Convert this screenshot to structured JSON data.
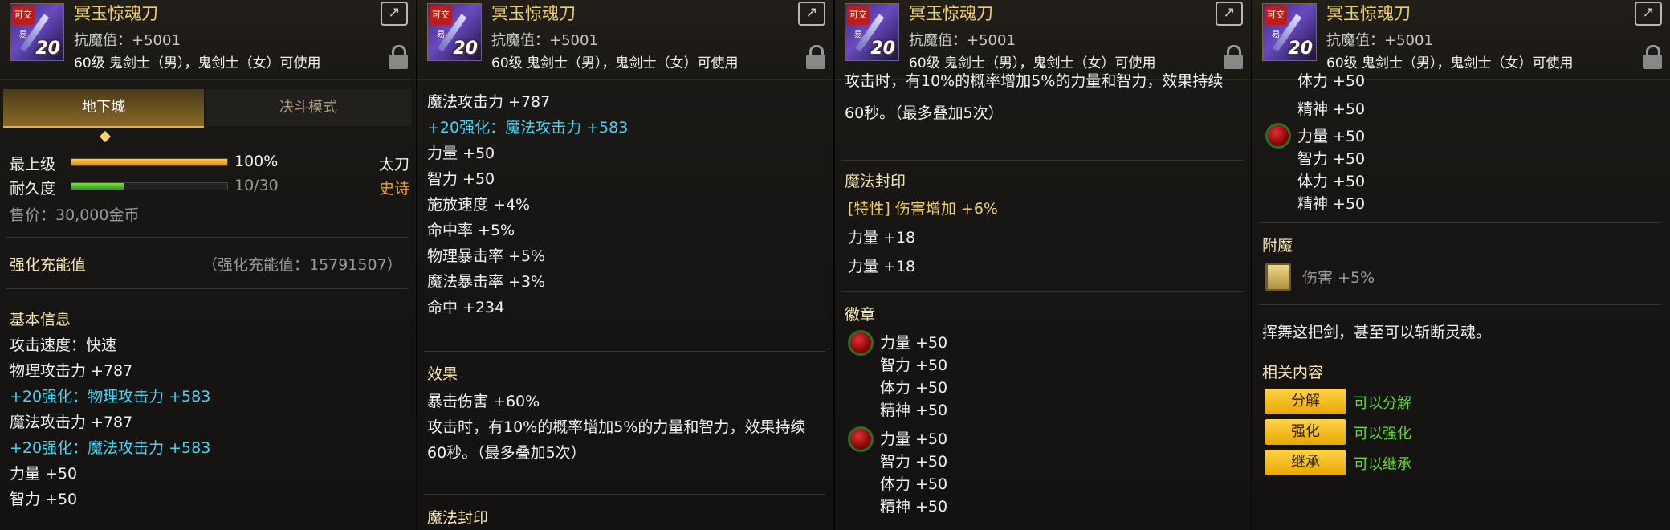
{
  "item": {
    "name": "冥玉惊魂刀",
    "resist": "抗魔值：+5001",
    "requirement": "60级 鬼剑士（男），鬼剑士（女）可使用",
    "badge": "可交易",
    "icon_level": "20"
  },
  "tabs": {
    "active": "地下城",
    "inactive": "决斗模式"
  },
  "grade": {
    "label": "最上级",
    "value": "100%",
    "progress": 1.0
  },
  "durability": {
    "label": "耐久度",
    "value": "10/30",
    "progress": 0.333
  },
  "weapon_type": "太刀",
  "rarity": "史诗",
  "sell_price": "售价：30,000金币",
  "reinforce": {
    "label": "强化充能值",
    "value": "（强化充能值：15791507）"
  },
  "basic": {
    "title": "基本信息",
    "speed": "攻击速度：快速",
    "phys_atk": "物理攻击力 +787",
    "phys_atk_bonus": "+20强化：物理攻击力 +583",
    "mag_atk": "魔法攻击力 +787",
    "mag_atk_bonus": "+20强化：魔法攻击力 +583",
    "str": "力量 +50",
    "int": "智力 +50",
    "cast_speed": "施放速度 +4%",
    "hit_rate": "命中率 +5%",
    "phys_crit": "物理暴击率 +5%",
    "mag_crit": "魔法暴击率 +3%",
    "hit": "命中 +234"
  },
  "effect": {
    "title": "效果",
    "crit_dmg": "暴击伤害 +60%",
    "desc1": "攻击时，有10%的概率增加5%的力量和智力，效果持续",
    "desc2": "60秒。（最多叠加5次）",
    "cut_top": "攻击时，有10%的概率增加5%的力量和智力，效果持续"
  },
  "seal": {
    "title": "魔法封印",
    "cut": "魔法封印",
    "trait": "[特性] 伤害增加 +6%",
    "line1": "力量 +18",
    "line2": "力量 +18"
  },
  "emblem": {
    "title": "徽章",
    "str": "力量 +50",
    "int": "智力 +50",
    "vit": "体力 +50",
    "spr": "精神 +50",
    "cut_top": "体力 +50"
  },
  "enchant": {
    "title": "附魔",
    "value": "伤害 +5%"
  },
  "flavor": "挥舞这把剑，甚至可以斩断灵魂。",
  "related": {
    "title": "相关内容",
    "buttons": [
      {
        "label": "分解",
        "note": "可以分解"
      },
      {
        "label": "强化",
        "note": "可以强化"
      },
      {
        "label": "继承",
        "note": "可以继承"
      }
    ]
  }
}
